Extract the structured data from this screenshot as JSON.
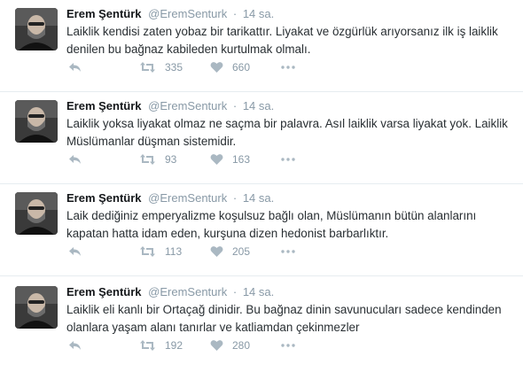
{
  "tweets": [
    {
      "name": "Erem Şentürk",
      "handle": "@EremSenturk",
      "separator": "·",
      "time": "14 sa.",
      "text": "Laiklik kendisi zaten yobaz bir tarikattır. Liyakat ve özgürlük arıyorsanız ilk iş laiklik denilen bu bağnaz kabileden kurtulmak olmalı.",
      "retweets": "335",
      "likes": "660"
    },
    {
      "name": "Erem Şentürk",
      "handle": "@EremSenturk",
      "separator": "·",
      "time": "14 sa.",
      "text": "Laiklik yoksa liyakat olmaz ne saçma bir palavra. Asıl laiklik varsa liyakat yok. Laiklik Müslümanlar düşman sistemidir.",
      "retweets": "93",
      "likes": "163"
    },
    {
      "name": "Erem Şentürk",
      "handle": "@EremSenturk",
      "separator": "·",
      "time": "14 sa.",
      "text": "Laik dediğiniz emperyalizme koşulsuz bağlı olan, Müslümanın bütün alanlarını kapatan hatta idam eden, kurşuna dizen hedonist barbarlıktır.",
      "retweets": "113",
      "likes": "205"
    },
    {
      "name": "Erem Şentürk",
      "handle": "@EremSenturk",
      "separator": "·",
      "time": "14 sa.",
      "text": "Laiklik eli kanlı bir Ortaçağ dinidir. Bu bağnaz dinin savunucuları sadece kendinden olanlara yaşam alanı tanırlar ve katliamdan çekinmezler",
      "retweets": "192",
      "likes": "280"
    }
  ],
  "icons": {
    "reply": "reply-icon",
    "retweet": "retweet-icon",
    "like": "heart-icon",
    "more": "more-icon"
  },
  "colors": {
    "text": "#292f33",
    "muted": "#8899a6",
    "icon": "#aab8c2",
    "divider": "#e6ecf0"
  }
}
